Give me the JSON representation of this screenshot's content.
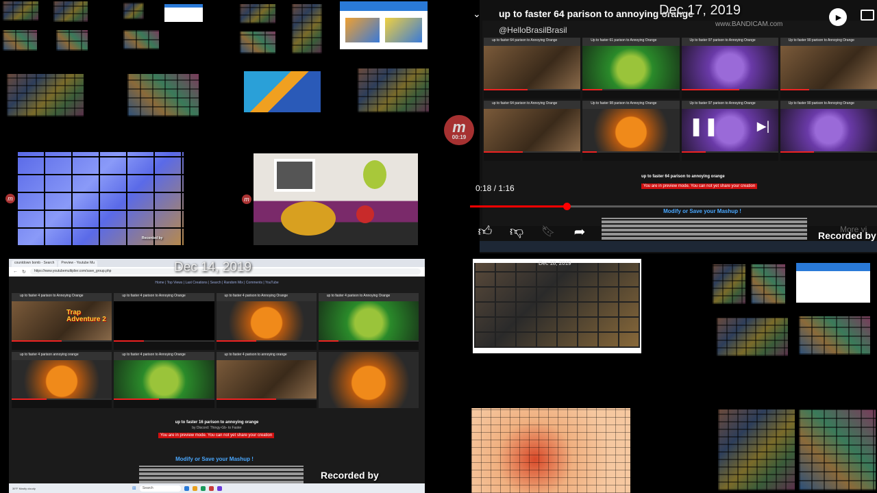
{
  "player": {
    "title": "up to faster 64 parison to annoying orange",
    "overlay_date": "Dec 17, 2019",
    "channel": "@HelloBrasilBrasil",
    "bandicam": "www.BANDICAM.com",
    "time": "0:18 / 1:16",
    "progress_fraction": 0.2368,
    "recorded_by": "Recorded by",
    "more": "More vi",
    "cards": [
      {
        "title": "up to faster 64 parison to Annoying Orange",
        "style": "brown-bg"
      },
      {
        "title": "Up to faster 61 parison to Annoying Orange",
        "style": "green-bg"
      },
      {
        "title": "Up to faster 97 parison to Annoying Orange",
        "style": "purple-bg"
      },
      {
        "title": "Up to faster 98 parison to Annoying Orange",
        "style": "orange-bg"
      },
      {
        "title": "Up to faster 97 parison to Annoying Orange",
        "style": "purple-bg"
      },
      {
        "title": "Up to faster 90 parison to Annoying Orange",
        "style": "brown-bg"
      }
    ],
    "warn": "You are in preview mode. You can not yet share your creation",
    "modify": "Modify or Save your Mashup !",
    "page_title": "up to faster 64 parison to annoying orange"
  },
  "recorder": {
    "logo_letter": "m",
    "logo_time": "00:19",
    "brand": "Mobizen"
  },
  "browser": {
    "tabs": [
      "countdown bomb - Search",
      "Preview - Youtube Mu"
    ],
    "url": "https://www.youtubemultiplier.com/save_group.php",
    "overlay_date": "Dec 14, 2019",
    "bandicam": "www.BANDICAM.com",
    "nav": "Home | Top Views | Last Creations | Search | Random Mix | Comments | YouTube",
    "page_title": "up to faster 16 parison to annoying orange",
    "page_author": "by Discord: Thingy-Gb- to Faster",
    "warn": "You are in preview mode. You can not yet share your creation",
    "modify": "Modify or Save your Mashup !",
    "cards": [
      {
        "title": "up to faster 4 parison to Annoying Orange",
        "style": "brown-bg",
        "overlay": "Trap Adventure 2"
      },
      {
        "title": "up to faster 4 parison to Annoying Orange",
        "style": "brown-bg",
        "overlay": ""
      },
      {
        "title": "up to faster 4 parison to Annoying Orange",
        "style": "orange-bg",
        "overlay": ""
      },
      {
        "title": "up to faster 4 parison to Annoying Orange",
        "style": "green-bg",
        "overlay": ""
      },
      {
        "title": "up to faster 4 parison annoying orange",
        "style": "orange-bg",
        "overlay": ""
      },
      {
        "title": "up to faster 4 parison to Annoying Orange",
        "style": "green-bg",
        "overlay": ""
      },
      {
        "title": "up to faster 4 parison to annoying orange",
        "style": "brown-bg",
        "overlay": ""
      },
      {
        "title": "",
        "style": "orange-bg",
        "overlay": ""
      }
    ],
    "taskbar_search": "Search",
    "weather": "39°F Mostly cloudy",
    "recorded_by": "Recorded by"
  },
  "small_overlays": {
    "third_date": "Dec 18, 2019",
    "recorded_by_small": "Recorded by"
  }
}
